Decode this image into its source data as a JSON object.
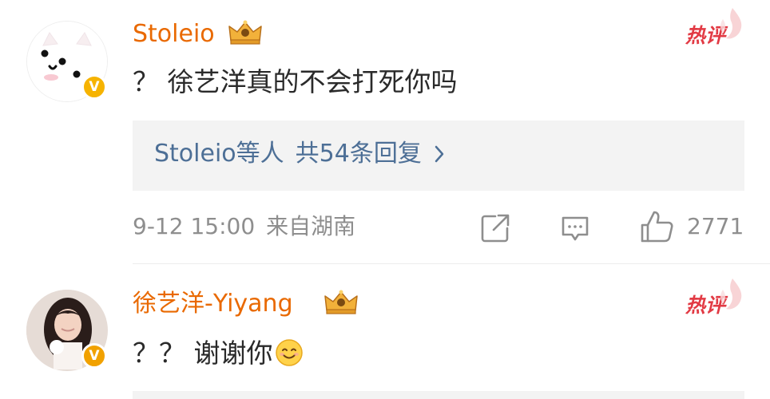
{
  "comments": [
    {
      "username": "Stoleio",
      "hot_label": "热评",
      "text": "？ 徐艺洋真的不会打死你吗",
      "reply_summary": {
        "who": "Stoleio等人",
        "count": "共54条回复"
      },
      "timestamp": "9-12 15:00",
      "location": "来自湖南",
      "likes": "2771"
    },
    {
      "username": "徐艺洋-Yiyang",
      "hot_label": "热评",
      "text": "？？ 谢谢你"
    }
  ],
  "colors": {
    "username": "#e96900",
    "hot": "#e23a44",
    "link": "#4d6f96",
    "meta": "#8e8e8e",
    "reply_bg": "#f3f3f3",
    "verified_badge": "#f6b300"
  },
  "icons": [
    "verified-badge-icon",
    "crown-badge-icon",
    "hot-flame-icon",
    "chevron-right-icon",
    "share-icon",
    "comment-icon",
    "thumbs-up-icon",
    "smile-emoji-icon"
  ]
}
